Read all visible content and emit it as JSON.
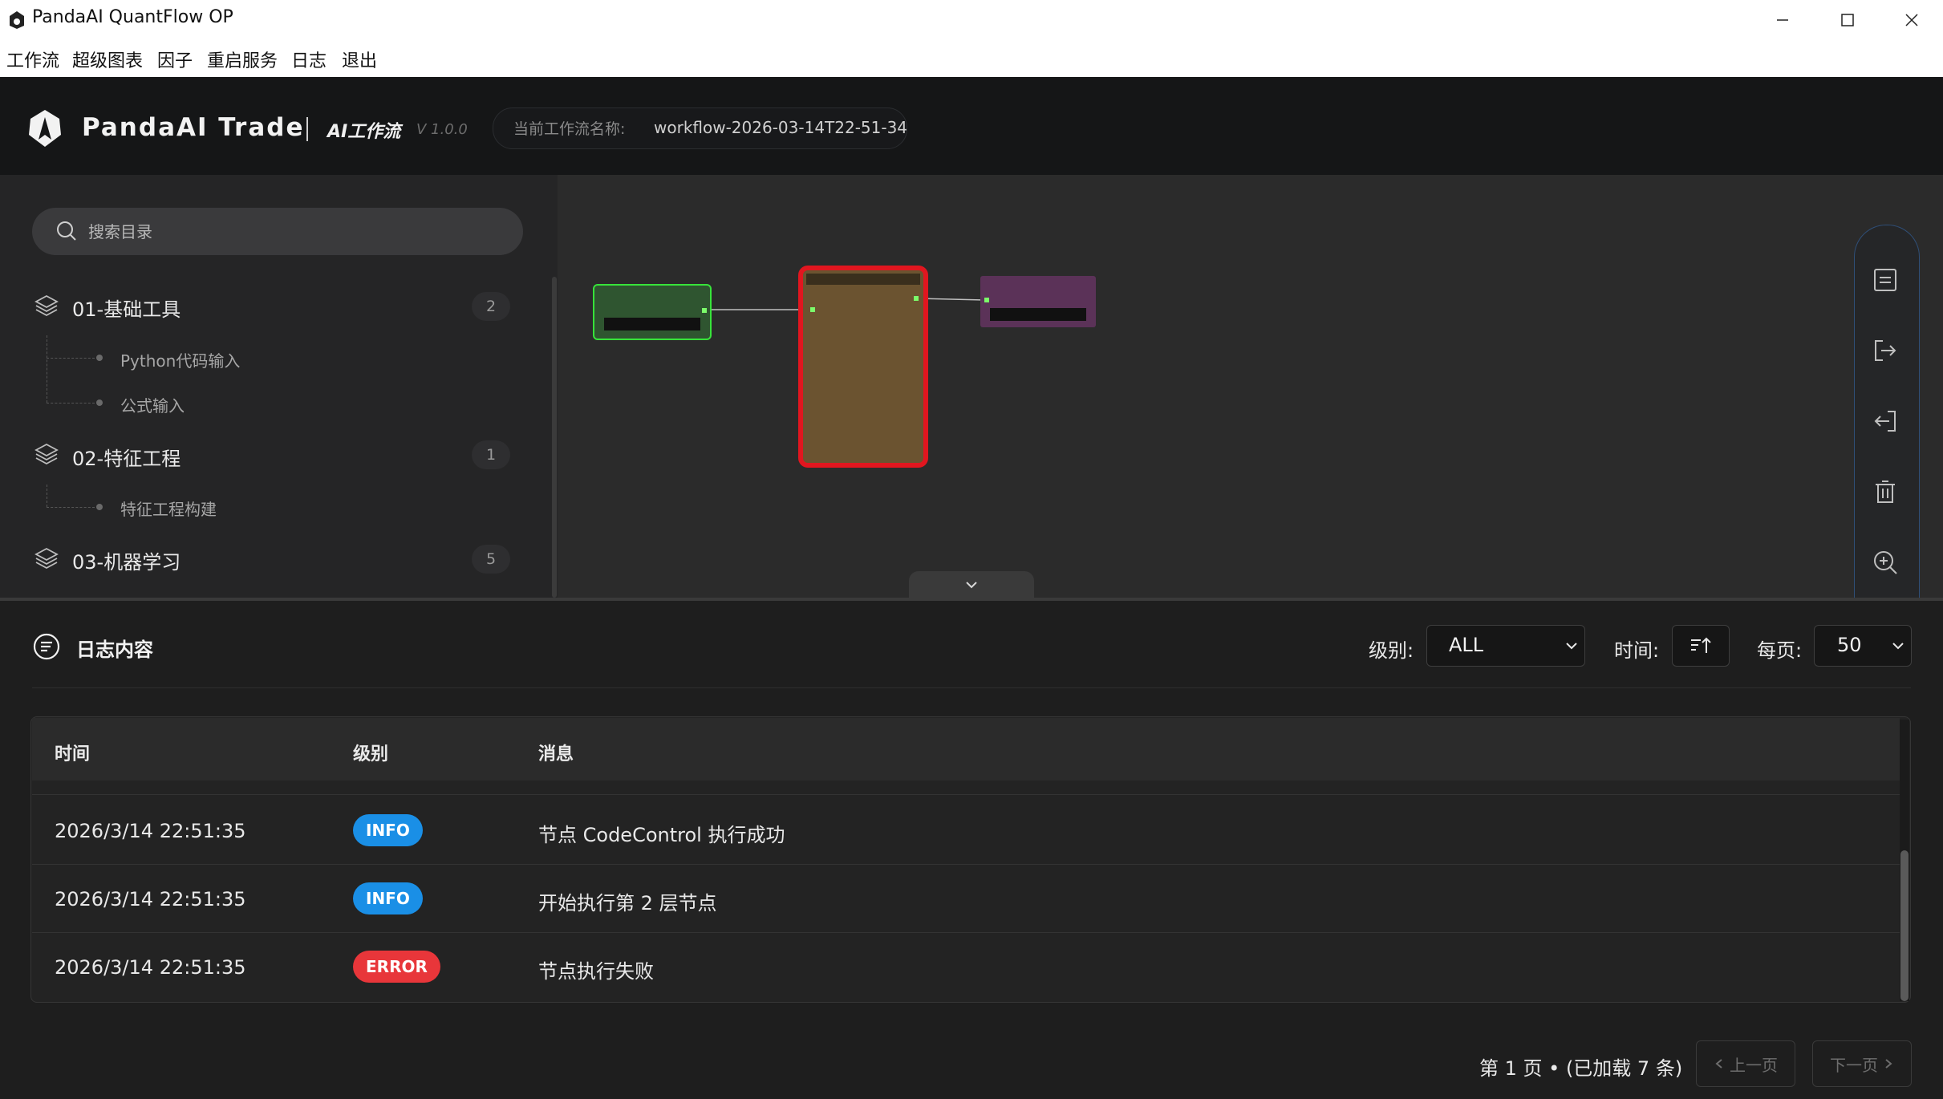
{
  "window": {
    "title": "PandaAI QuantFlow OP"
  },
  "menu": [
    "工作流",
    "超级图表",
    "因子",
    "重启服务",
    "日志",
    "退出"
  ],
  "header": {
    "brand": "PandaAI Trade",
    "subtitle": "AI工作流",
    "version": "V 1.0.0",
    "workflow_label": "当前工作流名称:",
    "workflow_name": "workflow-2026-03-14T22-51-34"
  },
  "sidebar": {
    "search_placeholder": "搜索目录",
    "categories": [
      {
        "title": "01-基础工具",
        "count": "2",
        "items": [
          "Python代码输入",
          "公式输入"
        ]
      },
      {
        "title": "02-特征工程",
        "count": "1",
        "items": [
          "特征工程构建"
        ]
      },
      {
        "title": "03-机器学习",
        "count": "5",
        "items": []
      }
    ]
  },
  "canvas": {
    "nodes": [
      {
        "kind": "input",
        "color": "#2f5530",
        "border": "#37e33a"
      },
      {
        "kind": "code",
        "color": "#6b5330",
        "border": "#e1161f",
        "state": "error"
      },
      {
        "kind": "output",
        "color": "#5b3258"
      }
    ],
    "toolbar": [
      "save-icon",
      "export-icon",
      "import-icon",
      "delete-icon",
      "zoom-in-icon"
    ]
  },
  "log": {
    "title": "日志内容",
    "level_label": "级别:",
    "level_value": "ALL",
    "time_label": "时间:",
    "per_page_label": "每页:",
    "per_page_value": "50",
    "columns": [
      "时间",
      "级别",
      "消息"
    ],
    "rows": [
      {
        "time": "2026/3/14 22:51:35",
        "level": "INFO",
        "message": "节点 CodeControl 执行成功"
      },
      {
        "time": "2026/3/14 22:51:35",
        "level": "INFO",
        "message": "开始执行第 2 层节点"
      },
      {
        "time": "2026/3/14 22:51:35",
        "level": "ERROR",
        "message": "节点执行失败"
      }
    ],
    "page_info": "第 1 页 • (已加载 7 条)",
    "prev_label": "上一页",
    "next_label": "下一页"
  },
  "colors": {
    "info": "#1a8fe6",
    "error": "#e8363a",
    "accent_border": "#2f4f78"
  }
}
